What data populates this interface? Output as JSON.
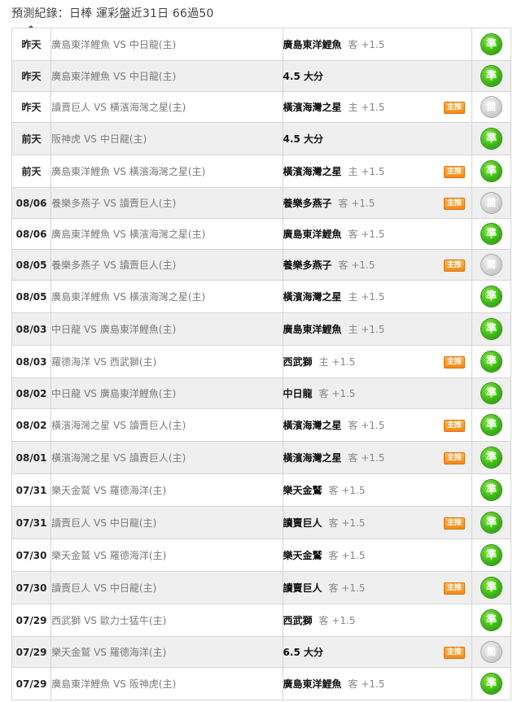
{
  "header": {
    "title": "預測紀錄：日棒 運彩盤近31日 66過50"
  },
  "badge_label": "主推",
  "rows": [
    {
      "day": "昨天",
      "home": "廣島東洋鯉魚",
      "away": "中日龍(主)",
      "pick": "廣島東洋鯉魚",
      "side": "客 +1.5",
      "featured": false,
      "result": "準",
      "hit": true
    },
    {
      "day": "昨天",
      "home": "廣島東洋鯉魚",
      "away": "中日龍(主)",
      "pick": "4.5 大分",
      "side": "",
      "featured": false,
      "result": "準",
      "hit": true
    },
    {
      "day": "昨天",
      "home": "讀賣巨人",
      "away": "橫濱海灣之星(主)",
      "pick": "橫濱海灣之星",
      "side": "主 +1.5",
      "featured": true,
      "result": "閣",
      "hit": false
    },
    {
      "day": "前天",
      "home": "阪神虎",
      "away": "中日龍(主)",
      "pick": "4.5 大分",
      "side": "",
      "featured": false,
      "result": "準",
      "hit": true
    },
    {
      "day": "前天",
      "home": "廣島東洋鯉魚",
      "away": "橫濱海灣之星(主)",
      "pick": "橫濱海灣之星",
      "side": "主 +1.5",
      "featured": true,
      "result": "準",
      "hit": true
    },
    {
      "day": "08/06",
      "home": "養樂多燕子",
      "away": "讀賣巨人(主)",
      "pick": "養樂多燕子",
      "side": "客 +1.5",
      "featured": true,
      "result": "閣",
      "hit": false
    },
    {
      "day": "08/06",
      "home": "廣島東洋鯉魚",
      "away": "橫濱海灣之星(主)",
      "pick": "廣島東洋鯉魚",
      "side": "客 +1.5",
      "featured": false,
      "result": "準",
      "hit": true
    },
    {
      "day": "08/05",
      "home": "養樂多燕子",
      "away": "讀賣巨人(主)",
      "pick": "養樂多燕子",
      "side": "客 +1.5",
      "featured": true,
      "result": "閣",
      "hit": false
    },
    {
      "day": "08/05",
      "home": "廣島東洋鯉魚",
      "away": "橫濱海灣之星(主)",
      "pick": "橫濱海灣之星",
      "side": "主 +1.5",
      "featured": false,
      "result": "準",
      "hit": true
    },
    {
      "day": "08/03",
      "home": "中日龍",
      "away": "廣島東洋鯉魚(主)",
      "pick": "廣島東洋鯉魚",
      "side": "主 +1.5",
      "featured": false,
      "result": "準",
      "hit": true
    },
    {
      "day": "08/03",
      "home": "羅德海洋",
      "away": "西武獅(主)",
      "pick": "西武獅",
      "side": "主 +1.5",
      "featured": true,
      "result": "準",
      "hit": true
    },
    {
      "day": "08/02",
      "home": "中日龍",
      "away": "廣島東洋鯉魚(主)",
      "pick": "中日龍",
      "side": "客 +1.5",
      "featured": false,
      "result": "準",
      "hit": true
    },
    {
      "day": "08/02",
      "home": "橫濱海灣之星",
      "away": "讀賣巨人(主)",
      "pick": "橫濱海灣之星",
      "side": "客 +1.5",
      "featured": true,
      "result": "準",
      "hit": true
    },
    {
      "day": "08/01",
      "home": "橫濱海灣之星",
      "away": "讀賣巨人(主)",
      "pick": "橫濱海灣之星",
      "side": "客 +1.5",
      "featured": true,
      "result": "準",
      "hit": true
    },
    {
      "day": "07/31",
      "home": "樂天金鷲",
      "away": "羅德海洋(主)",
      "pick": "樂天金鷲",
      "side": "客 +1.5",
      "featured": false,
      "result": "準",
      "hit": true
    },
    {
      "day": "07/31",
      "home": "讀賣巨人",
      "away": "中日龍(主)",
      "pick": "讀賣巨人",
      "side": "客 +1.5",
      "featured": true,
      "result": "準",
      "hit": true
    },
    {
      "day": "07/30",
      "home": "樂天金鷲",
      "away": "羅德海洋(主)",
      "pick": "樂天金鷲",
      "side": "客 +1.5",
      "featured": false,
      "result": "準",
      "hit": true
    },
    {
      "day": "07/30",
      "home": "讀賣巨人",
      "away": "中日龍(主)",
      "pick": "讀賣巨人",
      "side": "客 +1.5",
      "featured": true,
      "result": "準",
      "hit": true
    },
    {
      "day": "07/29",
      "home": "西武獅",
      "away": "歐力士猛牛(主)",
      "pick": "西武獅",
      "side": "客 +1.5",
      "featured": false,
      "result": "準",
      "hit": true
    },
    {
      "day": "07/29",
      "home": "樂天金鷲",
      "away": "羅德海洋(主)",
      "pick": "6.5 大分",
      "side": "",
      "featured": true,
      "result": "閣",
      "hit": false
    },
    {
      "day": "07/29",
      "home": "廣島東洋鯉魚",
      "away": "阪神虎(主)",
      "pick": "廣島東洋鯉魚",
      "side": "客 +1.5",
      "featured": false,
      "result": "準",
      "hit": true
    }
  ]
}
